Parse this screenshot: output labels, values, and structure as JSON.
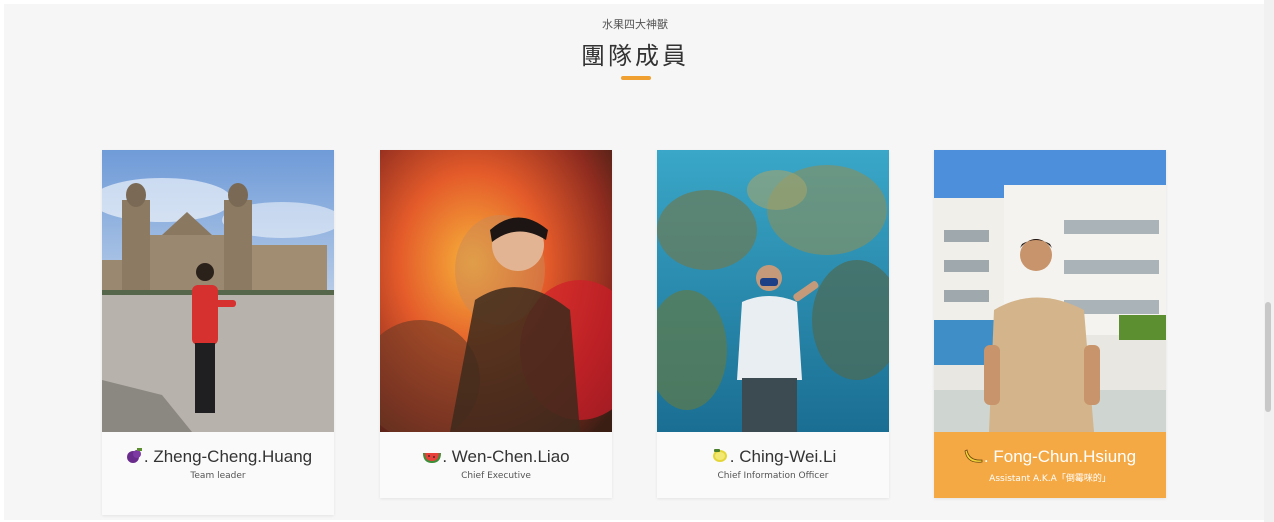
{
  "header": {
    "subtitle": "水果四大神獸",
    "title": "團隊成員"
  },
  "members": [
    {
      "emoji": "grape-icon",
      "name": ". Zheng-Cheng.Huang",
      "role": "Team leader"
    },
    {
      "emoji": "watermelon-icon",
      "name": ". Wen-Chen.Liao",
      "role": "Chief Executive"
    },
    {
      "emoji": "lemon-icon",
      "name": ". Ching-Wei.Li",
      "role": "Chief Information Officer"
    },
    {
      "emoji": "banana-icon",
      "name": ". Fong-Chun.Hsiung",
      "role": "Assistant A.K.A「倒霉咪的」"
    }
  ],
  "colors": {
    "accent": "#f0a030",
    "highlight_card": "#f5a944"
  }
}
